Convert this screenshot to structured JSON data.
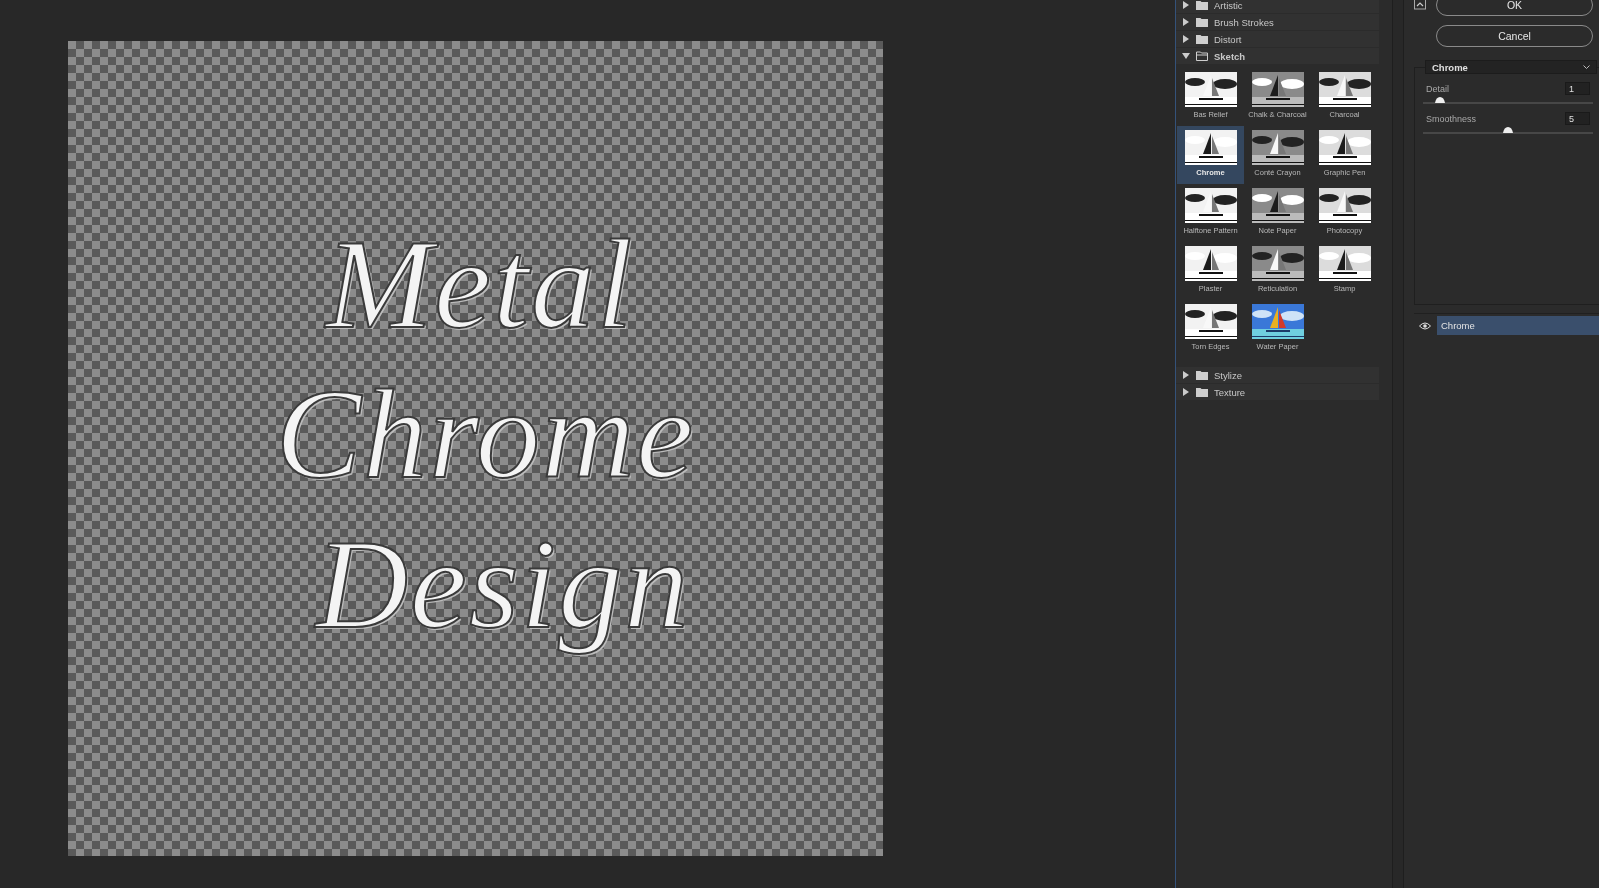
{
  "canvas": {
    "lines": [
      "Metal",
      "Chrome",
      "Design"
    ]
  },
  "filter_groups": [
    {
      "label": "Artistic",
      "expanded": false
    },
    {
      "label": "Brush Strokes",
      "expanded": false
    },
    {
      "label": "Distort",
      "expanded": false
    },
    {
      "label": "Sketch",
      "expanded": true,
      "filters": [
        {
          "label": "Bas Relief",
          "selected": false
        },
        {
          "label": "Chalk & Charcoal",
          "selected": false
        },
        {
          "label": "Charcoal",
          "selected": false
        },
        {
          "label": "Chrome",
          "selected": true
        },
        {
          "label": "Conté Crayon",
          "selected": false
        },
        {
          "label": "Graphic Pen",
          "selected": false
        },
        {
          "label": "Halftone Pattern",
          "selected": false
        },
        {
          "label": "Note Paper",
          "selected": false
        },
        {
          "label": "Photocopy",
          "selected": false
        },
        {
          "label": "Plaster",
          "selected": false
        },
        {
          "label": "Reticulation",
          "selected": false
        },
        {
          "label": "Stamp",
          "selected": false
        },
        {
          "label": "Torn Edges",
          "selected": false
        },
        {
          "label": "Water Paper",
          "selected": false
        }
      ]
    },
    {
      "label": "Stylize",
      "expanded": false
    },
    {
      "label": "Texture",
      "expanded": false
    }
  ],
  "buttons": {
    "ok": "OK",
    "cancel": "Cancel"
  },
  "filter_select": {
    "value": "Chrome"
  },
  "params": [
    {
      "label": "Detail",
      "value": "1",
      "level": 0.1
    },
    {
      "label": "Smoothness",
      "value": "5",
      "level": 0.5
    }
  ],
  "effect_layers": [
    {
      "label": "Chrome",
      "visible": true,
      "selected": true
    }
  ]
}
